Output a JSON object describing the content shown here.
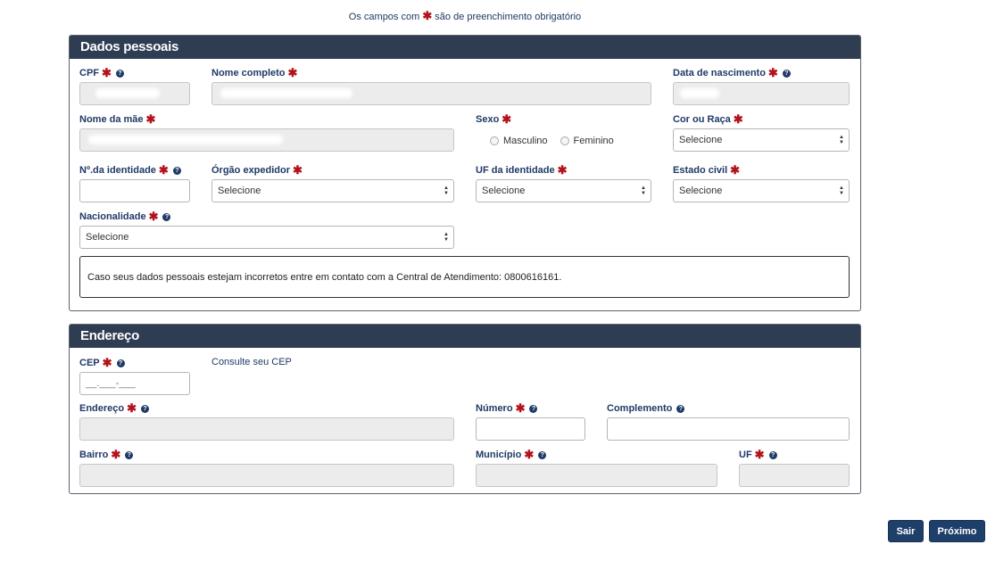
{
  "top_note": {
    "prefix": "Os campos com",
    "asterisk": "✱",
    "suffix": "são de preenchimento obrigatório"
  },
  "dados_pessoais": {
    "title": "Dados pessoais",
    "cpf_label": "CPF",
    "nome_label": "Nome completo",
    "nascimento_label": "Data de nascimento",
    "mae_label": "Nome da mãe",
    "sexo_label": "Sexo",
    "sexo_options": [
      "Masculino",
      "Feminino"
    ],
    "cor_label": "Cor ou Raça",
    "cor_value": "Selecione",
    "identidade_label": "Nº.da identidade",
    "orgao_label": "Órgão expedidor",
    "orgao_value": "Selecione",
    "uf_identidade_label": "UF da identidade",
    "uf_identidade_value": "Selecione",
    "estado_civil_label": "Estado civil",
    "estado_civil_value": "Selecione",
    "nacionalidade_label": "Nacionalidade",
    "nacionalidade_value": "Selecione",
    "info_text": "Caso seus dados pessoais estejam incorretos entre em contato com a Central de Atendimento: 0800616161."
  },
  "endereco": {
    "title": "Endereço",
    "cep_label": "CEP",
    "cep_placeholder": "__.___-___",
    "consulte_cep": "Consulte seu CEP",
    "endereco_label": "Endereço",
    "numero_label": "Número",
    "complemento_label": "Complemento",
    "bairro_label": "Bairro",
    "municipio_label": "Município",
    "uf_label": "UF"
  },
  "buttons": {
    "sair": "Sair",
    "proximo": "Próximo"
  },
  "icons": {
    "required": "asterisk-icon",
    "help": "question-circle-icon",
    "select": "select-arrows-icon"
  },
  "colors": {
    "header_bg": "#2e3d52",
    "required": "#b3121b",
    "button_bg": "#1f3f6b",
    "text": "#1f3a66"
  }
}
